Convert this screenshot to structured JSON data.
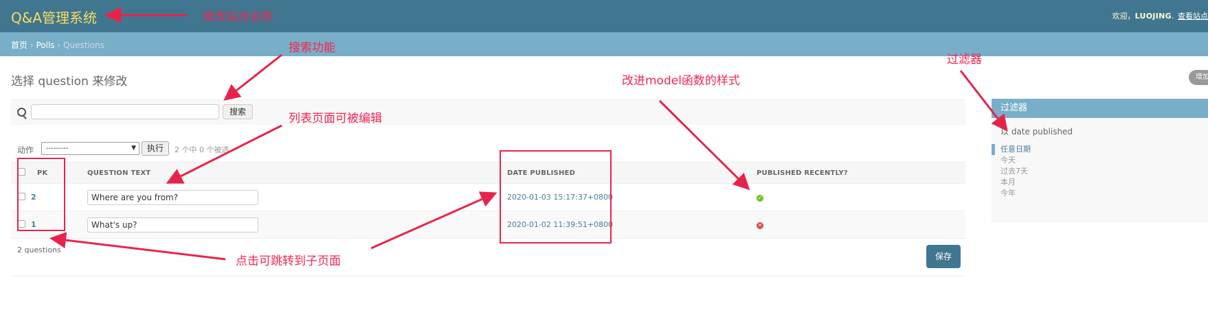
{
  "header": {
    "site_name": "Q&A管理系统",
    "welcome": "欢迎，",
    "username": "LUOJING",
    "view_site": "查看站点"
  },
  "breadcrumbs": {
    "home": "首页",
    "app": "Polls",
    "current": "Questions",
    "separator": "›"
  },
  "page": {
    "title": "选择 question 来修改",
    "add_button": "增加"
  },
  "search": {
    "button": "搜索",
    "value": ""
  },
  "actions": {
    "label": "动作",
    "selected": "---------",
    "go": "执行",
    "counter": "2 个中 0 个被选"
  },
  "table": {
    "headers": {
      "pk": "PK",
      "question_text": "QUESTION TEXT",
      "date_published": "DATE PUBLISHED",
      "published_recently": "PUBLISHED RECENTLY?"
    },
    "rows": [
      {
        "pk": "2",
        "question_text": "Where are you from?",
        "date_published": "2020-01-03 15:17:37+0800",
        "published_recently": true
      },
      {
        "pk": "1",
        "question_text": "What's up?",
        "date_published": "2020-01-02 11:39:51+0800",
        "published_recently": false
      }
    ]
  },
  "paginator": {
    "count": "2 questions",
    "save": "保存"
  },
  "filter": {
    "title": "过滤器",
    "by": "以 date published",
    "options": [
      "任意日期",
      "今天",
      "过去7天",
      "本月",
      "今年"
    ],
    "selected_index": 0
  },
  "annotations": {
    "site_name": "修改站点名称",
    "search": "搜索功能",
    "filter": "过滤器",
    "model_style": "改进model函数的样式",
    "editable": "列表页面可被编辑",
    "clickable": "点击可跳转到子页面"
  },
  "colors": {
    "header": "#417690",
    "breadcrumbs": "#79aec8",
    "site_name": "#f5dd5d",
    "annotation": "#f42552"
  }
}
